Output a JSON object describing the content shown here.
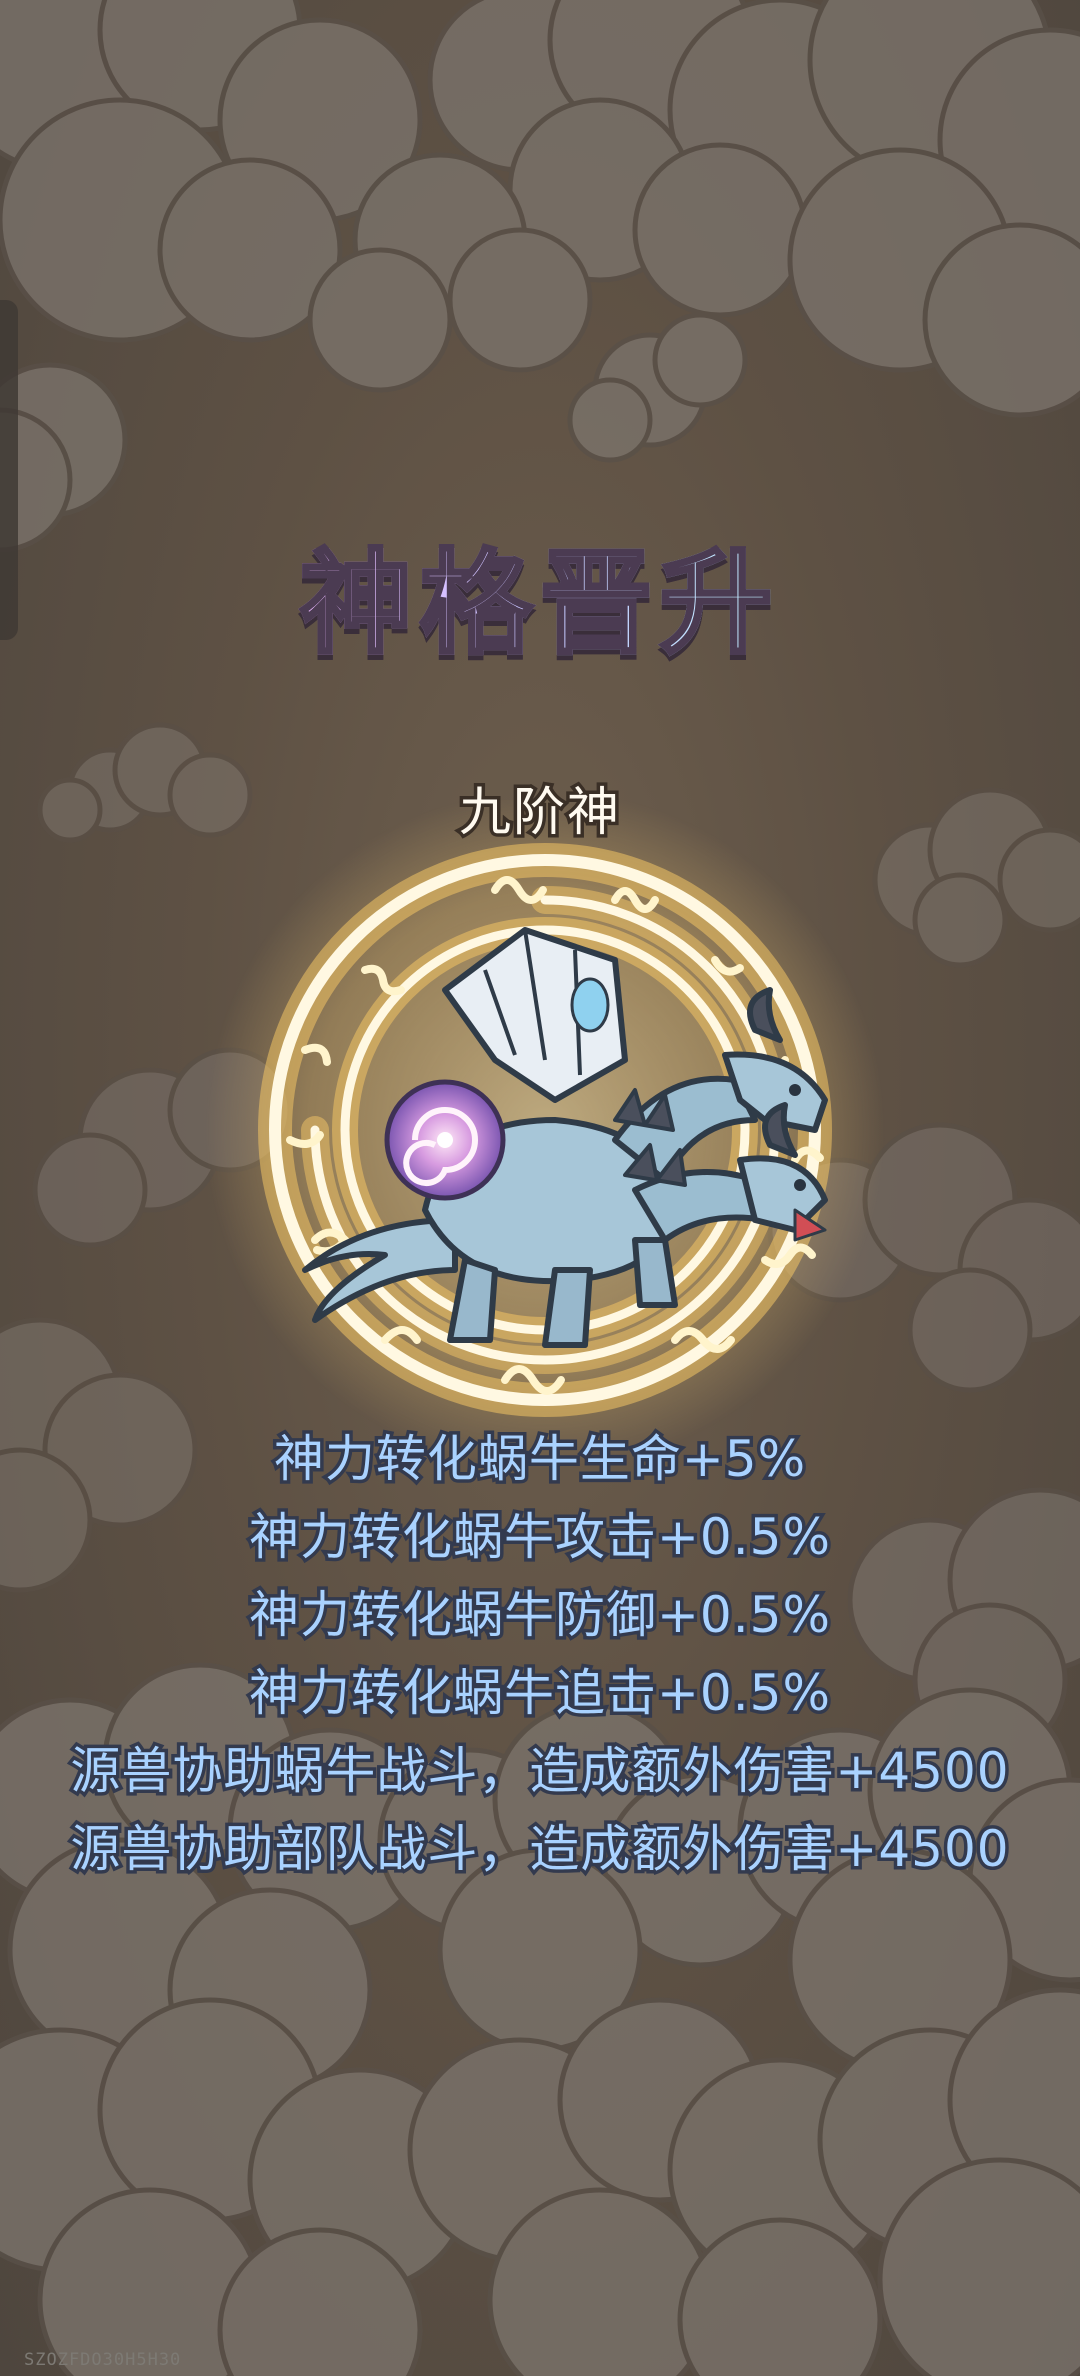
{
  "page": {
    "title": "神格晋升",
    "rank": "九阶神",
    "bonuses": [
      "神力转化蜗牛生命+5%",
      "神力转化蜗牛攻击+0.5%",
      "神力转化蜗牛防御+0.5%",
      "神力转化蜗牛追击+0.5%",
      "源兽协助蜗牛战斗，造成额外伤害+4500",
      "源兽协助部队战斗，造成额外伤害+4500"
    ],
    "watermark": "SZOZFDO30H5H30"
  },
  "icons": {
    "emblem": "golden-rune-circle-icon",
    "creature": "ice-dragon-icon",
    "orb": "galaxy-orb-icon"
  },
  "colors": {
    "background": "#5e5144",
    "cloud_fill": "#7d7570",
    "cloud_outline": "#5b524b",
    "ring_glow": "#ffdf96",
    "ring_core": "#fffbea",
    "bonus_text": "#a9d2ff",
    "dragon_body": "#a7c6d8"
  }
}
